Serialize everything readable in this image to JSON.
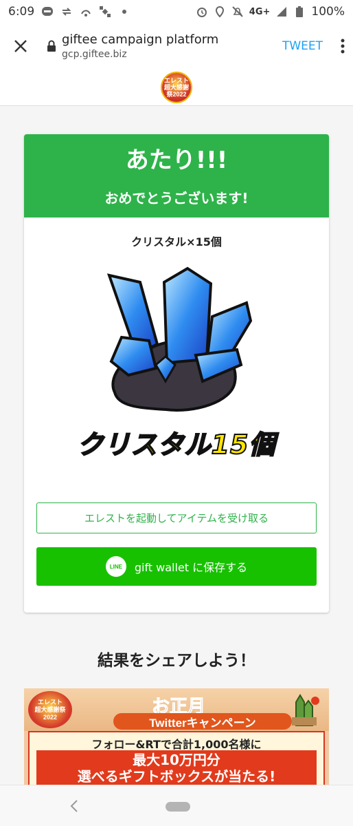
{
  "status_bar": {
    "time": "6:09",
    "network": "4G+",
    "battery": "100%"
  },
  "browser": {
    "page_name": "giftee campaign platform",
    "domain": "gcp.giftee.biz",
    "tweet_label": "TWEET"
  },
  "header": {
    "logo_text": "エレスト超大感謝祭2022"
  },
  "result": {
    "hit_title": "あたり!!!",
    "congrats": "おめでとうございます!",
    "prize_name": "クリスタル×15個",
    "prize_image_caption": "クリスタル15個",
    "receive_button": "エレストを起動してアイテムを受け取る",
    "line_logo_text": "LINE",
    "wallet_button": "gift wallet に保存する"
  },
  "share": {
    "title": "結果をシェアしよう！",
    "banner": {
      "emblem_text_1": "エレスト",
      "emblem_text_2": "超大感謝祭",
      "emblem_text_3": "2022",
      "headline": "お正月",
      "campaign_label": "Twitterキャンペーン",
      "follow_text": "フォロー&RTで合計1,000名様に",
      "prize_line_1": "最大10万円分",
      "prize_line_2": "選べるギフトボックスが当たる!"
    }
  },
  "colors": {
    "accent_green": "#2eb34a",
    "line_green": "#17c100",
    "tweet_blue": "#1da1f2",
    "banner_red": "#e23a1c"
  },
  "icons": [
    "close-icon",
    "lock-icon",
    "more-vert-icon",
    "line-logo-icon",
    "back-icon",
    "home-pill-icon",
    "crystal-icon"
  ]
}
